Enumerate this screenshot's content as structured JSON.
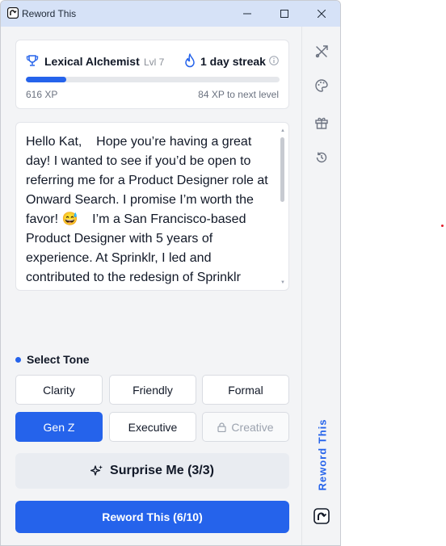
{
  "window": {
    "title": "Reword This"
  },
  "progress": {
    "badge_name": "Lexical Alchemist",
    "level": "Lvl 7",
    "streak": "1 day streak",
    "xp_current": "616 XP",
    "xp_remaining": "84 XP to next level",
    "progress_fraction": 0.16
  },
  "message": {
    "text": "Hello Kat,    Hope you’re having a great day! I wanted to see if you’d be open to referring me for a Product Designer role at Onward Search. I promise I’m worth the favor! 😅    I’m a San Francisco-based Product Designer with 5 years of experience. At Sprinklr, I led and contributed to the redesign of Sprinklr"
  },
  "tone": {
    "heading": "Select Tone",
    "options": [
      {
        "label": "Clarity",
        "state": "default"
      },
      {
        "label": "Friendly",
        "state": "default"
      },
      {
        "label": "Formal",
        "state": "default"
      },
      {
        "label": "Gen Z",
        "state": "selected"
      },
      {
        "label": "Executive",
        "state": "default"
      },
      {
        "label": "Creative",
        "state": "locked"
      }
    ]
  },
  "actions": {
    "surprise": "Surprise Me (3/3)",
    "reword": "Reword This (6/10)"
  },
  "rail": {
    "brand": "Reword This",
    "icons": [
      "tools-icon",
      "palette-icon",
      "gift-icon",
      "history-icon"
    ]
  },
  "colors": {
    "accent": "#2563eb",
    "titlebar": "#d6e2f7"
  }
}
